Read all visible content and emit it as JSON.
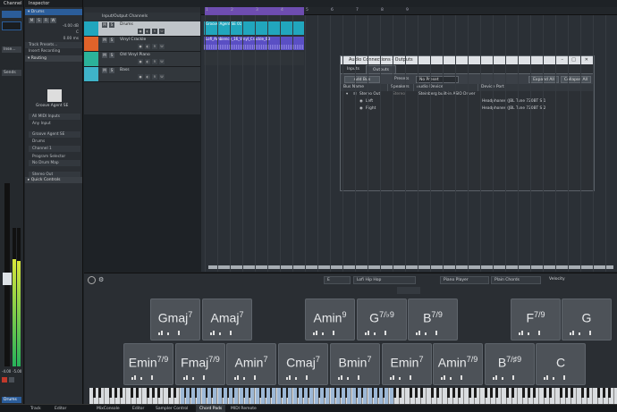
{
  "colors": {
    "accent_blue": "#2b5d9a",
    "drums": "#21a6bd",
    "vinyl": "#e0632a",
    "piano": "#2bb39a",
    "bass": "#3fb3c9",
    "cycle": "#7b55c9"
  },
  "channel": {
    "title": "Channel",
    "send_label": "Inse...",
    "sends_label": "Sends",
    "readout_left": "-4.00",
    "readout_right": "-5.00",
    "track_name": "Drums"
  },
  "inspector": {
    "title": "Inspector",
    "track_header": "Drums",
    "volume": "-4.00 dB",
    "pan": "C",
    "delay": "0.00 ms",
    "track_presets": "Track Presets...",
    "insert_recording": "Insert Recording",
    "routing_header": "Routing",
    "instrument_name": "Groove Agent SE",
    "midi_input": "All MIDI Inputs",
    "any_input": "Any Input",
    "output_instrument": "Groove Agent SE",
    "output_sub": "Drums",
    "channel": "Channel 1",
    "program_selector": "Program Selector",
    "drum_map": "No Drum Map",
    "audio_out": "Stereo Out",
    "quick_controls": "Quick Controls"
  },
  "tracks": [
    {
      "name": "Input/Output Channels"
    },
    {
      "name": "Drums"
    },
    {
      "name": "Vinyl Crackle"
    },
    {
      "name": "Old Vinyl Piano"
    },
    {
      "name": "Bass"
    }
  ],
  "track_buttons": {
    "m": "M",
    "s": "S",
    "r": "R",
    "w": "W"
  },
  "ruler": [
    "1",
    "2",
    "3",
    "4",
    "5",
    "6",
    "7",
    "8",
    "9"
  ],
  "events": {
    "drums_event": "Groove Agent SE 01",
    "vinyl_event": "Lofi_Ambience_16_Vinyl_Crackle_03"
  },
  "dialog": {
    "title": "Audio Connections - Outputs",
    "tabs": [
      "Inputs",
      "Outputs"
    ],
    "add_bus": "Add Bus",
    "presets_label": "Presets",
    "preset_value": "No Preset",
    "expand_all": "Expand All",
    "collapse_all": "Collapse All",
    "columns": [
      "Bus Name",
      "Speakers",
      "Audio Device",
      "Device Port"
    ],
    "bus": {
      "name": "Stereo Out",
      "speakers": "Stereo",
      "device": "Steinberg built-in ASIO Driver"
    },
    "ports": [
      {
        "name": "Left",
        "port": "Headphones (JBL Tune 720BT S 1"
      },
      {
        "name": "Right",
        "port": "Headphones (JBL Tune 720BT S 2"
      }
    ]
  },
  "chord_toolbar": {
    "key": "E",
    "style": "Lofi Hip Hop",
    "player": "Piano Player",
    "chords": "Plain Chords",
    "velocity": "Velocity"
  },
  "pads_row1": [
    {
      "root": "Gmaj",
      "ext": "7"
    },
    {
      "root": "Amaj",
      "ext": "7"
    },
    {
      "root": "Amin",
      "ext": "9"
    },
    {
      "root": "G",
      "ext": "7/♭9"
    },
    {
      "root": "B",
      "ext": "7/9"
    },
    {
      "root": "F",
      "ext": "7/9"
    },
    {
      "root": "G",
      "ext": ""
    }
  ],
  "pads_row2": [
    {
      "root": "Emin",
      "ext": "7/9"
    },
    {
      "root": "Fmaj",
      "ext": "7/9"
    },
    {
      "root": "Amin",
      "ext": "7"
    },
    {
      "root": "Cmaj",
      "ext": "7"
    },
    {
      "root": "Bmin",
      "ext": "7"
    },
    {
      "root": "Emin",
      "ext": "7"
    },
    {
      "root": "Amin",
      "ext": "7/9"
    },
    {
      "root": "B",
      "ext": "7/♯9"
    },
    {
      "root": "C",
      "ext": ""
    }
  ],
  "bottom_tabs": [
    "Track",
    "Editor",
    "MixConsole",
    "Editor",
    "Sampler Control",
    "Chord Pads",
    "MIDI Remote"
  ]
}
